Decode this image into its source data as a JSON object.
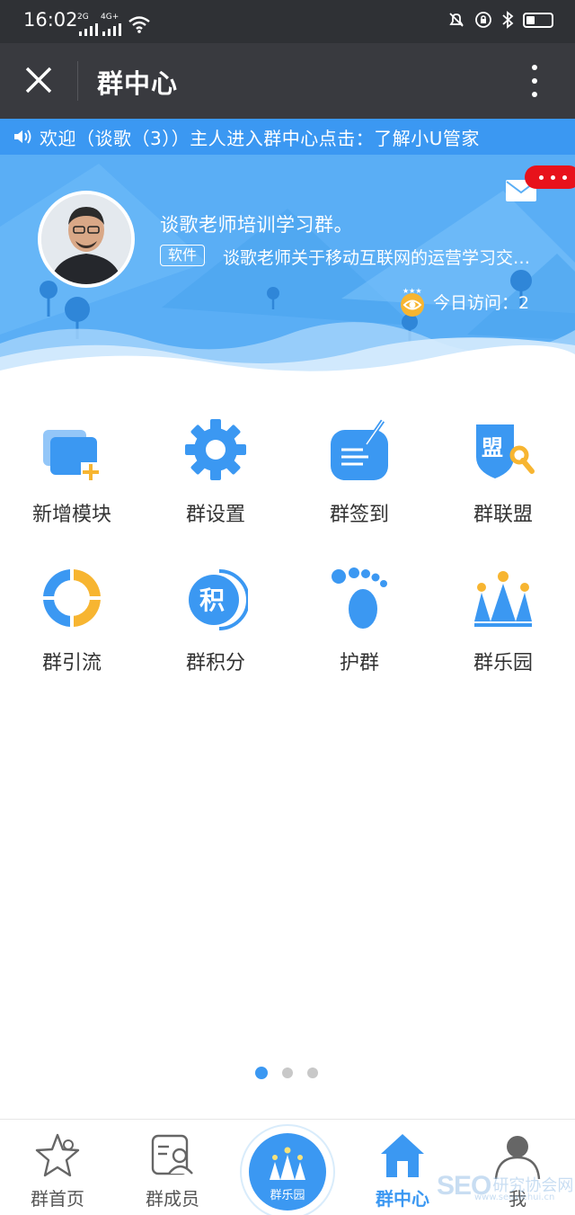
{
  "status_bar": {
    "time": "16:02",
    "network_1": "2G",
    "network_2": "4G+"
  },
  "title_bar": {
    "title": "群中心",
    "close_icon": "close-icon",
    "more_icon": "more-vertical-icon"
  },
  "notice": {
    "icon": "speaker-icon",
    "text": "欢迎（谈歌（3））主人进入群中心点击：了解小U管家"
  },
  "group": {
    "name": "谈歌老师培训学习群。",
    "tag": "软件",
    "description": "谈歌老师关于移动互联网的运营学习交流群",
    "visits_label": "今日访问：2",
    "visits_today": 2
  },
  "modules": [
    {
      "label": "新增模块",
      "icon": "add-module-icon"
    },
    {
      "label": "群设置",
      "icon": "gear-icon"
    },
    {
      "label": "群签到",
      "icon": "sign-in-icon"
    },
    {
      "label": "群联盟",
      "icon": "alliance-shield-icon"
    },
    {
      "label": "群引流",
      "icon": "traffic-ring-icon"
    },
    {
      "label": "群积分",
      "icon": "points-icon"
    },
    {
      "label": "护群",
      "icon": "footprint-icon"
    },
    {
      "label": "群乐园",
      "icon": "crown-icon"
    }
  ],
  "modules_extra": {
    "points_glyph": "积",
    "alliance_glyph": "盟"
  },
  "pager": {
    "pages": 3,
    "current": 1
  },
  "tabs": [
    {
      "label": "群首页",
      "icon": "star-icon"
    },
    {
      "label": "群成员",
      "icon": "members-icon"
    },
    {
      "label": "群乐园",
      "icon": "crown-icon"
    },
    {
      "label": "群中心",
      "icon": "home-icon",
      "active": true
    },
    {
      "label": "我",
      "icon": "user-icon"
    }
  ],
  "watermark": {
    "brand": "SEO",
    "text": "研究协会网",
    "url": "www.seoxiehui.cn"
  },
  "colors": {
    "accent": "#3b98f2",
    "title_bar": "#393a3f",
    "status_bar": "#2f3135",
    "badge": "#e8121b",
    "orange": "#f7b531"
  }
}
